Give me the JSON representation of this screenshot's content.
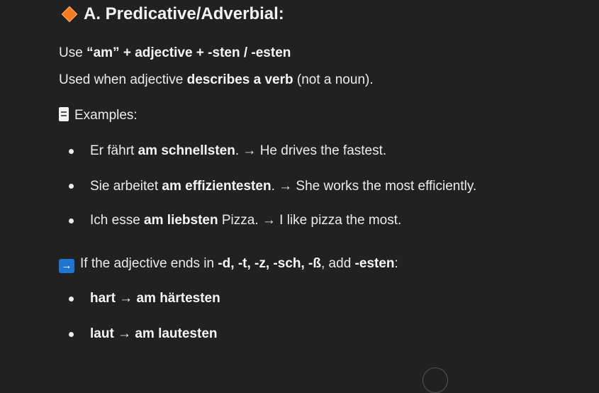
{
  "section": {
    "title": "A. Predicative/Adverbial:",
    "icon": "orange-diamond-icon"
  },
  "rule": {
    "pre": "Use ",
    "formula": "“am” + adjective + -sten / -esten"
  },
  "usage": {
    "pre": "Used when adjective ",
    "bold": "describes a verb",
    "post": " (not a noun)."
  },
  "examples_label": "Examples:",
  "examples": [
    {
      "pre": "Er fährt ",
      "bold": "am schnellsten",
      "post": ". → He drives the fastest."
    },
    {
      "pre": "Sie arbeitet ",
      "bold": "am effizientesten",
      "post": ". → She works the most efficiently."
    },
    {
      "pre": "Ich esse ",
      "bold": "am liebsten",
      "post": " Pizza. → I like pizza the most."
    }
  ],
  "note": {
    "arrow": "→",
    "pre": "If the adjective ends in ",
    "endings": "-d, -t, -z, -sch, -ß",
    "mid": ", add ",
    "suffix": "-esten",
    "post": ":"
  },
  "esten_examples": [
    {
      "text": "hart → am härtesten"
    },
    {
      "text": "laut → am lautesten"
    }
  ]
}
